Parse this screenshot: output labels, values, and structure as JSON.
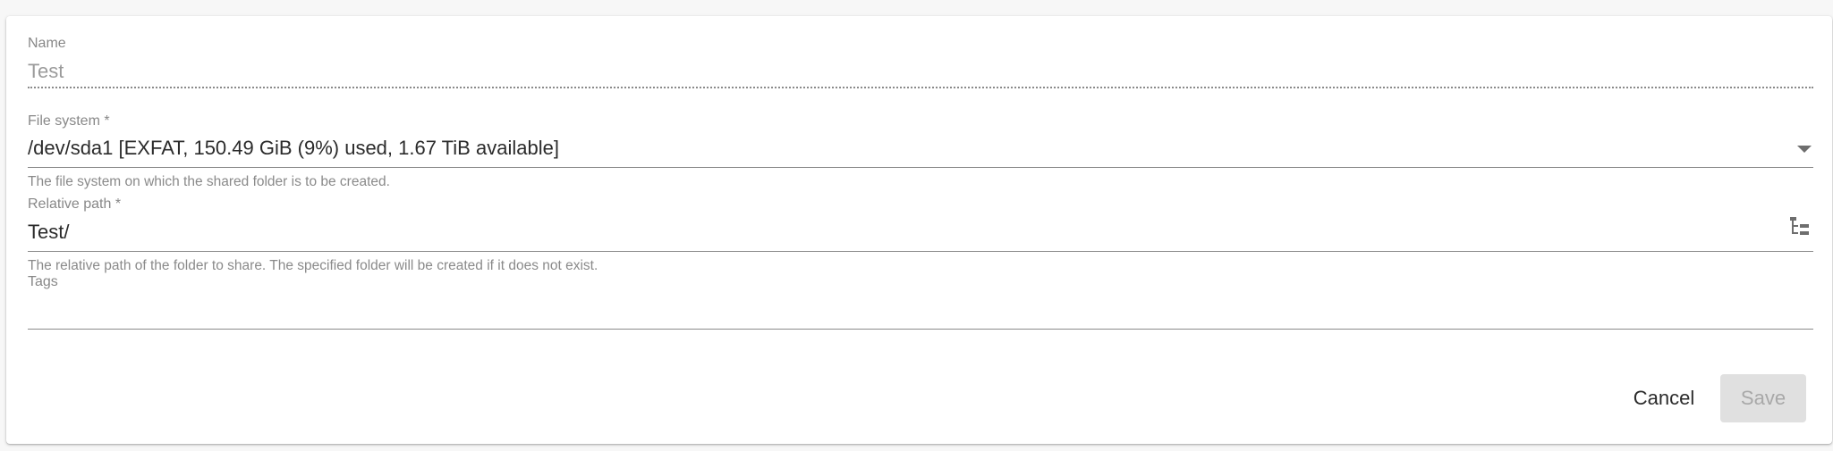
{
  "form": {
    "name": {
      "label": "Name",
      "value": "Test"
    },
    "filesystem": {
      "label": "File system *",
      "value": "/dev/sda1 [EXFAT, 150.49 GiB (9%) used, 1.67 TiB available]",
      "hint": "The file system on which the shared folder is to be created."
    },
    "relative_path": {
      "label": "Relative path *",
      "value": "Test/",
      "hint": "The relative path of the folder to share. The specified folder will be created if it does not exist."
    },
    "tags": {
      "label": "Tags",
      "value": ""
    }
  },
  "actions": {
    "cancel_label": "Cancel",
    "save_label": "Save"
  },
  "icons": {
    "dropdown": "chevron-down-icon",
    "folder_tree": "folder-tree-icon"
  }
}
